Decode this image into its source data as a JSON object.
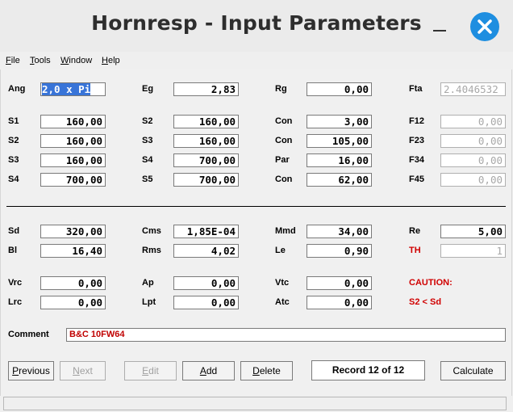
{
  "window": {
    "title": "Hornresp - Input Parameters"
  },
  "menu": {
    "file": "File",
    "tools": "Tools",
    "window": "Window",
    "help": "Help"
  },
  "params": {
    "ang": {
      "label": "Ang",
      "value": "2,0 x Pi"
    },
    "eg": {
      "label": "Eg",
      "value": "2,83"
    },
    "rg": {
      "label": "Rg",
      "value": "0,00"
    },
    "fta": {
      "label": "Fta",
      "value": "2.4046532"
    },
    "s1": {
      "label": "S1",
      "value": "160,00"
    },
    "s2": {
      "label": "S2",
      "value": "160,00"
    },
    "s3": {
      "label": "S3",
      "value": "160,00"
    },
    "s4": {
      "label": "S4",
      "value": "700,00"
    },
    "c2_s2": {
      "label": "S2",
      "value": "160,00"
    },
    "c2_s3": {
      "label": "S3",
      "value": "160,00"
    },
    "c2_s4": {
      "label": "S4",
      "value": "700,00"
    },
    "c2_s5": {
      "label": "S5",
      "value": "700,00"
    },
    "con1": {
      "label": "Con",
      "value": "3,00"
    },
    "con2": {
      "label": "Con",
      "value": "105,00"
    },
    "par": {
      "label": "Par",
      "value": "16,00"
    },
    "con3": {
      "label": "Con",
      "value": "62,00"
    },
    "f12": {
      "label": "F12",
      "value": "0,00"
    },
    "f23": {
      "label": "F23",
      "value": "0,00"
    },
    "f34": {
      "label": "F34",
      "value": "0,00"
    },
    "f45": {
      "label": "F45",
      "value": "0,00"
    },
    "sd": {
      "label": "Sd",
      "value": "320,00"
    },
    "bl": {
      "label": "Bl",
      "value": "16,40"
    },
    "cms": {
      "label": "Cms",
      "value": "1,85E-04"
    },
    "rms": {
      "label": "Rms",
      "value": "4,02"
    },
    "mmd": {
      "label": "Mmd",
      "value": "34,00"
    },
    "le": {
      "label": "Le",
      "value": "0,90"
    },
    "re": {
      "label": "Re",
      "value": "5,00"
    },
    "th": {
      "label": "TH",
      "value": "1"
    },
    "vrc": {
      "label": "Vrc",
      "value": "0,00"
    },
    "lrc": {
      "label": "Lrc",
      "value": "0,00"
    },
    "ap": {
      "label": "Ap",
      "value": "0,00"
    },
    "lpt": {
      "label": "Lpt",
      "value": "0,00"
    },
    "vtc": {
      "label": "Vtc",
      "value": "0,00"
    },
    "atc": {
      "label": "Atc",
      "value": "0,00"
    }
  },
  "caution": {
    "title": "CAUTION:",
    "message": "S2 < Sd"
  },
  "comment": {
    "label": "Comment",
    "value": "B&C 10FW64"
  },
  "buttons": {
    "previous": "Previous",
    "next": "Next",
    "edit": "Edit",
    "add": "Add",
    "delete": "Delete",
    "calculate": "Calculate"
  },
  "record": "Record 12 of 12",
  "colors": {
    "accent": "#1e8ee0",
    "warning": "#d00000",
    "selection": "#3874d8"
  }
}
